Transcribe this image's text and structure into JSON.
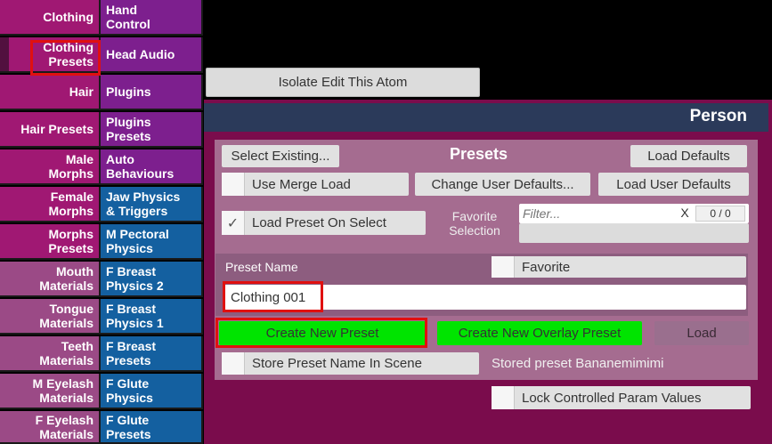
{
  "tabs": [
    {
      "left": [
        "Clothing"
      ],
      "right": [
        "Hand",
        "Control"
      ]
    },
    {
      "left": [
        "Clothing",
        "Presets"
      ],
      "right": [
        "Head Audio"
      ]
    },
    {
      "left": [
        "Hair"
      ],
      "right": [
        "Plugins"
      ]
    },
    {
      "left": [
        "Hair Presets"
      ],
      "right": [
        "Plugins",
        "Presets"
      ]
    },
    {
      "left": [
        "Male",
        "Morphs"
      ],
      "right": [
        "Auto",
        "Behaviours"
      ]
    },
    {
      "left": [
        "Female",
        "Morphs"
      ],
      "right": [
        "Jaw Physics",
        "& Triggers"
      ]
    },
    {
      "left": [
        "Morphs",
        "Presets"
      ],
      "right": [
        "M Pectoral",
        "Physics"
      ]
    },
    {
      "left": [
        "Mouth",
        "Materials"
      ],
      "right": [
        "F Breast",
        "Physics 2"
      ]
    },
    {
      "left": [
        "Tongue",
        "Materials"
      ],
      "right": [
        "F Breast",
        "Physics 1"
      ]
    },
    {
      "left": [
        "Teeth",
        "Materials"
      ],
      "right": [
        "F Breast",
        "Presets"
      ]
    },
    {
      "left": [
        "M Eyelash",
        "Materials"
      ],
      "right": [
        "F Glute",
        "Physics"
      ]
    },
    {
      "left": [
        "F Eyelash",
        "Materials"
      ],
      "right": [
        "F Glute",
        "Presets"
      ]
    }
  ],
  "isolate_button": "Isolate Edit This Atom",
  "panel_title": "Person",
  "presets": {
    "title": "Presets",
    "select_existing": "Select Existing...",
    "load_defaults": "Load Defaults",
    "use_merge_load": "Use Merge Load",
    "change_user_defaults": "Change User Defaults...",
    "load_user_defaults": "Load User Defaults",
    "load_preset_on_select": "Load Preset On Select",
    "load_preset_on_select_checked": "✓",
    "favorite_selection": [
      "Favorite",
      "Selection"
    ],
    "filter_placeholder": "Filter...",
    "filter_clear": "X",
    "filter_count": "0 / 0",
    "preset_name_label": "Preset Name",
    "favorite": "Favorite",
    "preset_name_value": "Clothing 001",
    "create_new_preset": "Create New Preset",
    "create_new_overlay_preset": "Create New Overlay Preset",
    "load": "Load",
    "store_preset_name": "Store Preset Name In Scene",
    "stored_preset": "Stored preset Bananemimimi",
    "lock_controlled": "Lock Controlled Param Values"
  },
  "colors": {
    "tab_magenta": "#a01873",
    "tab_purple": "#7d1f8e",
    "tab_blue": "#1460a0",
    "panel_bg": "#7a0c4c",
    "panel_header": "#2b3a5a",
    "green_button": "#00e400",
    "highlight_red": "#e01010"
  }
}
